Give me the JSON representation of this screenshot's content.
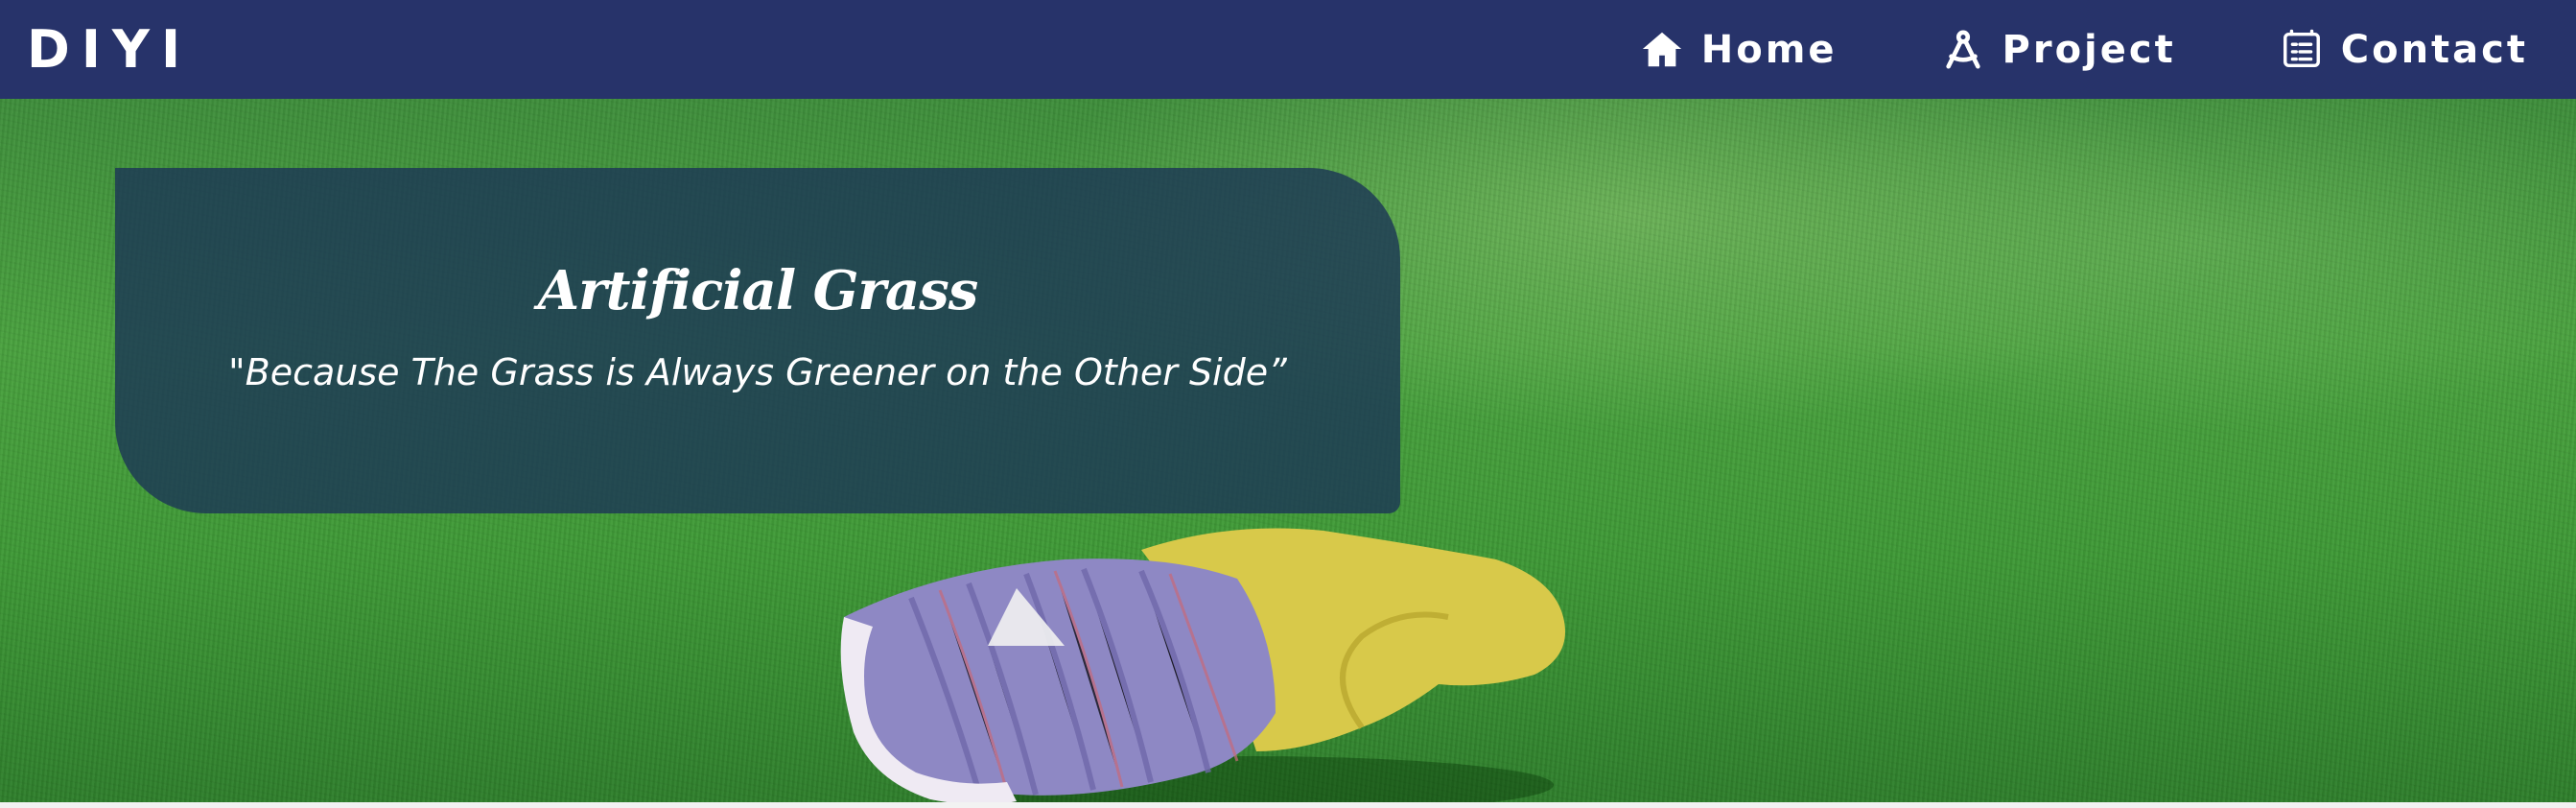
{
  "navbar": {
    "brand": "DIYI",
    "background": "#27336a",
    "links": [
      {
        "label": "Home",
        "icon": "home-icon"
      },
      {
        "label": "Project",
        "icon": "compass-icon"
      },
      {
        "label": "Contact",
        "icon": "contact-list-icon"
      }
    ]
  },
  "hero": {
    "title": "Artificial Grass",
    "tagline": "\"Because The Grass is Always Greener on the Other Side”",
    "card_color": "#1c3755"
  }
}
